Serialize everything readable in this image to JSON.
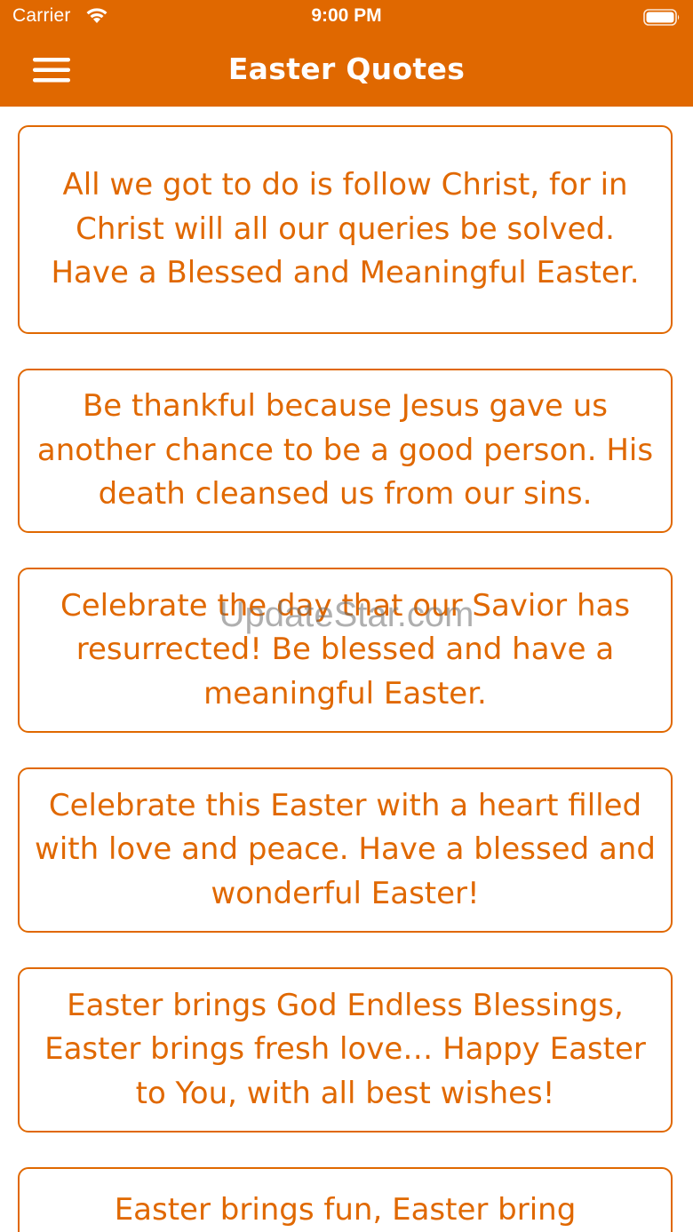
{
  "status_bar": {
    "carrier": "Carrier",
    "time": "9:00 PM"
  },
  "nav": {
    "title": "Easter Quotes"
  },
  "colors": {
    "accent": "#e06800",
    "background": "#ffffff"
  },
  "quotes": [
    "All we got to do is follow Christ, for in Christ will all our queries be solved. Have a Blessed and Meaningful Easter.",
    "Be thankful because Jesus gave us another chance to be a good person. His death cleansed us from our sins.",
    "Celebrate the day that our Savior has resurrected!  Be blessed and have a meaningful Easter.",
    "Celebrate this Easter with a heart filled with love and peace. Have a blessed and wonderful Easter!",
    "Easter brings God Endless Blessings, Easter brings fresh love…  Happy Easter to You, with all best wishes!",
    "Easter brings fun, Easter bring"
  ],
  "watermark": "UpdateStar.com"
}
